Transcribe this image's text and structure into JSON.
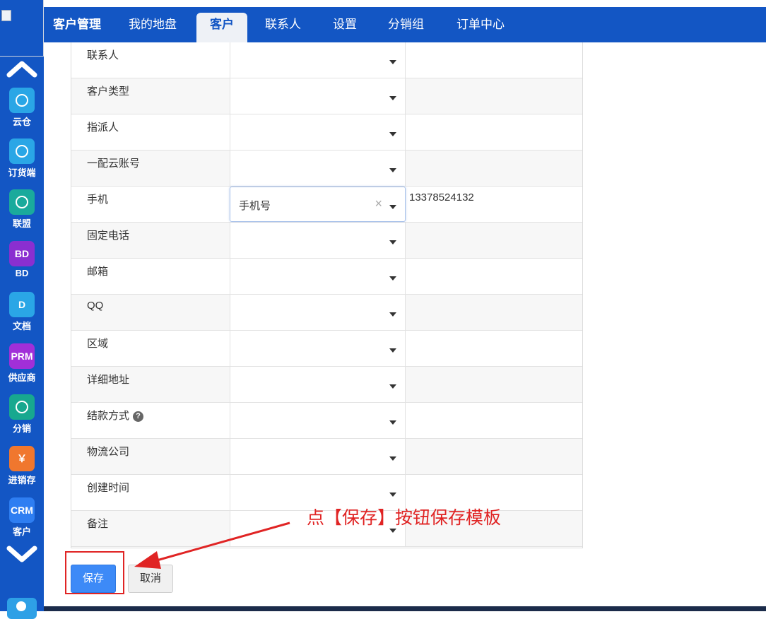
{
  "nav": {
    "brand": "客户管理",
    "tabs": [
      "我的地盘",
      "客户",
      "联系人",
      "设置",
      "分销组",
      "订单中心"
    ],
    "active_tab": "客户"
  },
  "sidebar": {
    "items": [
      {
        "label": "云仓",
        "icon": "cloud-icon",
        "icon_text": "",
        "color": "#2aa6e6"
      },
      {
        "label": "订货端",
        "icon": "chat-icon",
        "icon_text": "",
        "color": "#2aa6e6"
      },
      {
        "label": "联盟",
        "icon": "handshake-icon",
        "icon_text": "",
        "color": "#1aaa9c"
      },
      {
        "label": "BD",
        "icon": "bd-icon",
        "icon_text": "BD",
        "color": "#8a2fd0"
      },
      {
        "label": "文档",
        "icon": "document-icon",
        "icon_text": "D",
        "color": "#2aa6e6"
      },
      {
        "label": "供应商",
        "icon": "prm-icon",
        "icon_text": "PRM",
        "color": "#a12fd8"
      },
      {
        "label": "分销",
        "icon": "network-icon",
        "icon_text": "",
        "color": "#17a88f"
      },
      {
        "label": "进销存",
        "icon": "yen-icon",
        "icon_text": "￥",
        "color": "#f0772e"
      },
      {
        "label": "客户",
        "icon": "crm-icon",
        "icon_text": "CRM",
        "color": "#2e7ef2"
      }
    ]
  },
  "form": {
    "rows": [
      {
        "label": "联系人",
        "selected": "",
        "value": ""
      },
      {
        "label": "客户类型",
        "selected": "",
        "value": ""
      },
      {
        "label": "指派人",
        "selected": "",
        "value": ""
      },
      {
        "label": "一配云账号",
        "selected": "",
        "value": ""
      },
      {
        "label": "手机",
        "selected": "手机号",
        "value": "13378524132"
      },
      {
        "label": "固定电话",
        "selected": "",
        "value": ""
      },
      {
        "label": "邮箱",
        "selected": "",
        "value": ""
      },
      {
        "label": "QQ",
        "selected": "",
        "value": ""
      },
      {
        "label": "区域",
        "selected": "",
        "value": ""
      },
      {
        "label": "详细地址",
        "selected": "",
        "value": ""
      },
      {
        "label": "结款方式",
        "selected": "",
        "value": "",
        "help": true
      },
      {
        "label": "物流公司",
        "selected": "",
        "value": ""
      },
      {
        "label": "创建时间",
        "selected": "",
        "value": ""
      },
      {
        "label": "备注",
        "selected": "",
        "value": ""
      }
    ]
  },
  "buttons": {
    "save": "保存",
    "cancel": "取消"
  },
  "annotation": {
    "text": "点【保存】按钮保存模板",
    "color": "#e02424"
  }
}
